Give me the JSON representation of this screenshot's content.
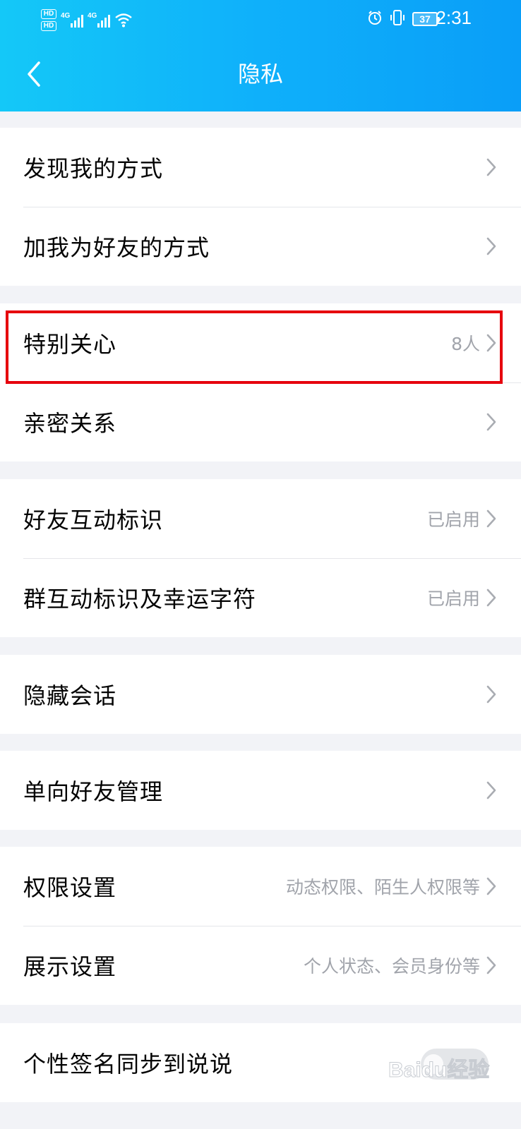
{
  "status_bar": {
    "hd1": "HD",
    "hd2": "HD",
    "net1": "4G",
    "net2": "4G",
    "battery": "37",
    "time": "2:31",
    "icons": [
      "signal-icon",
      "wifi-icon",
      "alarm-icon",
      "vibrate-icon",
      "battery-icon"
    ]
  },
  "header": {
    "title": "隐私",
    "back_icon": "chevron-left-icon"
  },
  "groups": [
    {
      "rows": [
        {
          "label": "发现我的方式",
          "value": ""
        },
        {
          "label": "加我为好友的方式",
          "value": ""
        }
      ]
    },
    {
      "rows": [
        {
          "label": "特别关心",
          "value": "8人"
        },
        {
          "label": "亲密关系",
          "value": ""
        }
      ]
    },
    {
      "rows": [
        {
          "label": "好友互动标识",
          "value": "已启用"
        },
        {
          "label": "群互动标识及幸运字符",
          "value": "已启用"
        }
      ]
    },
    {
      "rows": [
        {
          "label": "隐藏会话",
          "value": ""
        }
      ]
    },
    {
      "rows": [
        {
          "label": "单向好友管理",
          "value": ""
        }
      ]
    },
    {
      "rows": [
        {
          "label": "权限设置",
          "value": "动态权限、陌生人权限等"
        },
        {
          "label": "展示设置",
          "value": "个人状态、会员身份等"
        }
      ]
    },
    {
      "rows": [
        {
          "label": "个性签名同步到说说",
          "value": ""
        }
      ]
    }
  ],
  "colors": {
    "header_start": "#14c8f8",
    "header_end": "#0a9ef8",
    "highlight": "#e6000d",
    "value_text": "#a1a4ab"
  },
  "watermark": "Baidu经验"
}
